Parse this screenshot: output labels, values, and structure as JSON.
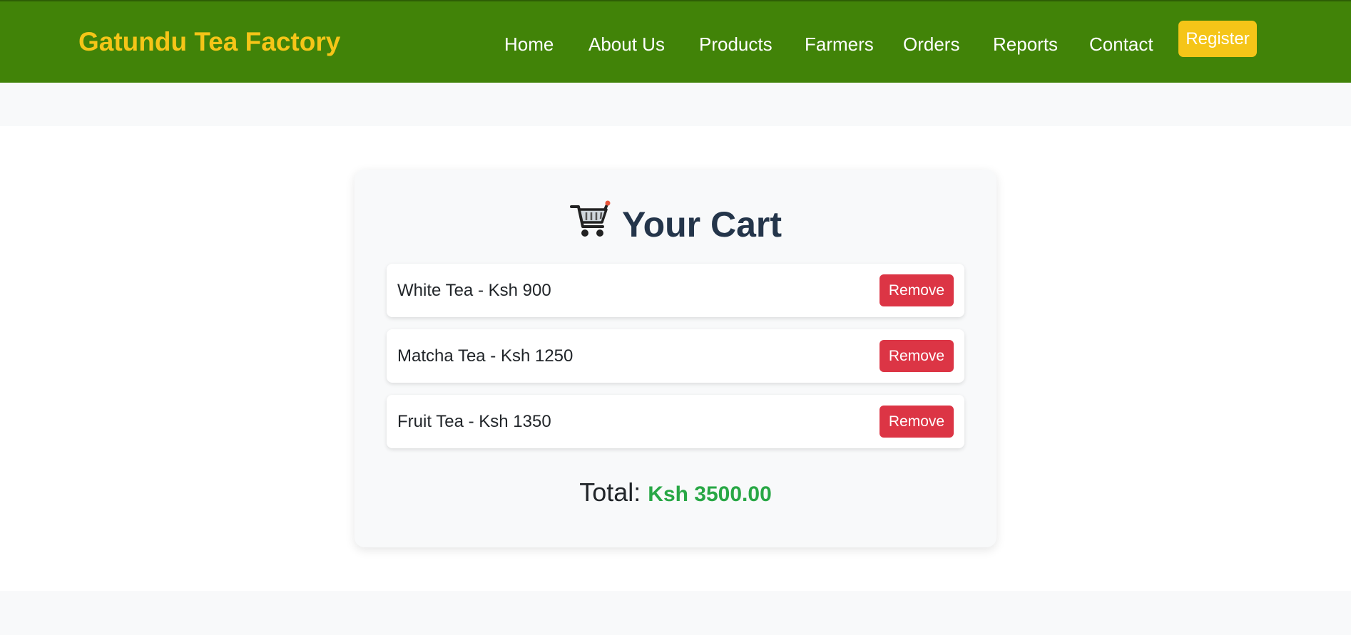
{
  "header": {
    "brand": "Gatundu Tea Factory",
    "nav": [
      "Home",
      "About Us",
      "Products",
      "Farmers",
      "Orders",
      "Reports",
      "Contact"
    ],
    "register_label": "Register"
  },
  "cart": {
    "icon": "shopping-cart-icon",
    "title": "Your Cart",
    "items": [
      {
        "text": "White Tea - Ksh 900",
        "remove_label": "Remove"
      },
      {
        "text": "Matcha Tea - Ksh 1250",
        "remove_label": "Remove"
      },
      {
        "text": "Fruit Tea - Ksh 1350",
        "remove_label": "Remove"
      }
    ],
    "total_label": "Total:",
    "total_value": "Ksh 3500.00"
  },
  "colors": {
    "navbar": "#418308",
    "brand": "#f5c518",
    "register": "#f5c518",
    "remove": "#dc3545",
    "total": "#28a745",
    "title": "#24354a"
  }
}
